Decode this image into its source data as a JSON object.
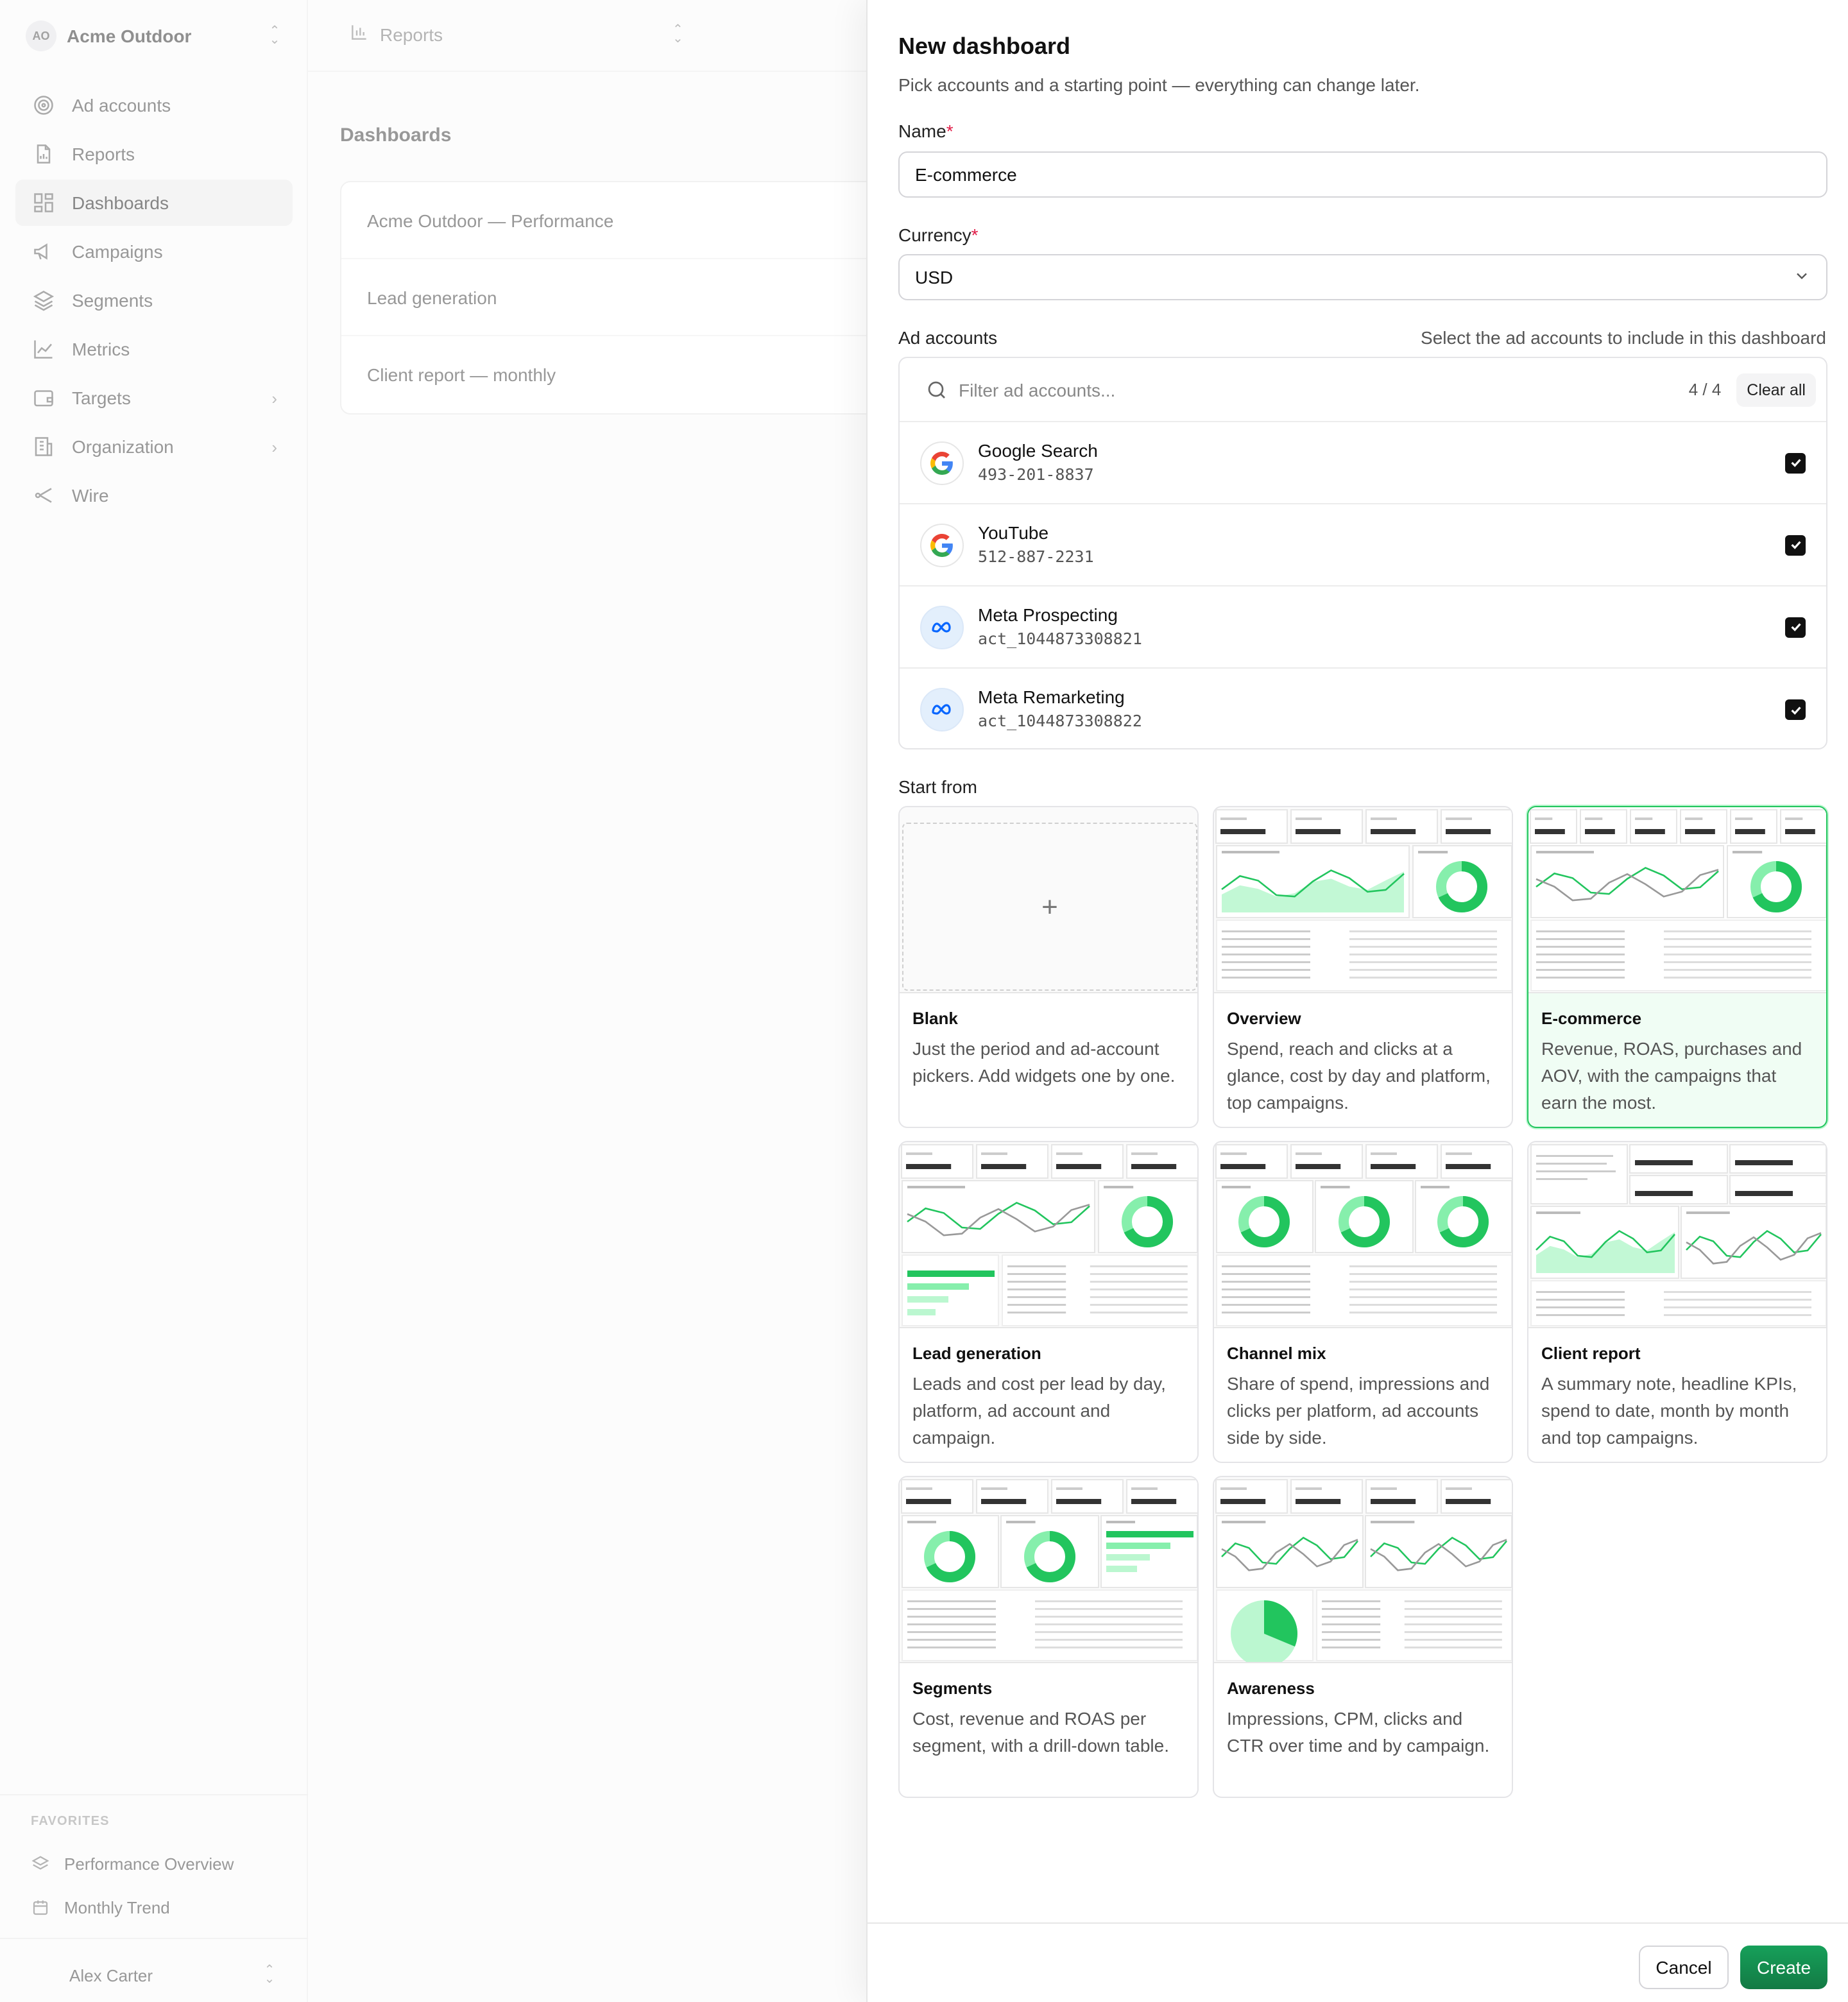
{
  "workspace": {
    "initials": "AO",
    "name": "Acme Outdoor"
  },
  "nav": [
    {
      "label": "Ad accounts",
      "icon": "target-icon"
    },
    {
      "label": "Reports",
      "icon": "file-chart-icon"
    },
    {
      "label": "Dashboards",
      "icon": "grid-icon",
      "active": true
    },
    {
      "label": "Campaigns",
      "icon": "megaphone-icon"
    },
    {
      "label": "Segments",
      "icon": "layers-icon"
    },
    {
      "label": "Metrics",
      "icon": "line-chart-icon"
    },
    {
      "label": "Targets",
      "icon": "wallet-icon",
      "chevron": true
    },
    {
      "label": "Organization",
      "icon": "building-icon",
      "chevron": true
    },
    {
      "label": "Wire",
      "icon": "share-icon"
    }
  ],
  "favorites": {
    "heading": "FAVORITES",
    "items": [
      {
        "label": "Performance Overview",
        "icon": "layers-icon"
      },
      {
        "label": "Monthly Trend",
        "icon": "calendar-icon"
      }
    ]
  },
  "user": {
    "name": "Alex Carter"
  },
  "topbar": {
    "crumb": "Reports"
  },
  "page": {
    "title": "Dashboards",
    "dashboards": [
      "Acme Outdoor — Performance",
      "Lead generation",
      "Client report — monthly"
    ]
  },
  "sheet": {
    "title": "New dashboard",
    "subtitle": "Pick accounts and a starting point — everything can change later.",
    "name_label": "Name",
    "name_value": "E-commerce",
    "currency_label": "Currency",
    "currency_value": "USD",
    "accounts_label": "Ad accounts",
    "accounts_hint": "Select the ad accounts to include in this dashboard",
    "filter_placeholder": "Filter ad accounts...",
    "selected_count": "4 / 4",
    "clear_all": "Clear all",
    "accounts": [
      {
        "name": "Google Search",
        "id": "493-201-8837",
        "platform": "google",
        "checked": true
      },
      {
        "name": "YouTube",
        "id": "512-887-2231",
        "platform": "google",
        "checked": true
      },
      {
        "name": "Meta Prospecting",
        "id": "act_1044873308821",
        "platform": "meta",
        "checked": true
      },
      {
        "name": "Meta Remarketing",
        "id": "act_1044873308822",
        "platform": "meta",
        "checked": true
      }
    ],
    "start_from_label": "Start from",
    "templates": [
      {
        "name": "Blank",
        "desc": "Just the period and ad-account pickers. Add widgets one by one.",
        "selected": false
      },
      {
        "name": "Overview",
        "desc": "Spend, reach and clicks at a glance, cost by day and platform, top campaigns.",
        "selected": false
      },
      {
        "name": "E-commerce",
        "desc": "Revenue, ROAS, purchases and AOV, with the campaigns that earn the most.",
        "selected": true
      },
      {
        "name": "Lead generation",
        "desc": "Leads and cost per lead by day, platform, ad account and campaign.",
        "selected": false
      },
      {
        "name": "Channel mix",
        "desc": "Share of spend, impressions and clicks per platform, ad accounts side by side.",
        "selected": false
      },
      {
        "name": "Client report",
        "desc": "A summary note, headline KPIs, spend to date, month by month and top campaigns.",
        "selected": false
      },
      {
        "name": "Segments",
        "desc": "Cost, revenue and ROAS per segment, with a drill-down table.",
        "selected": false
      },
      {
        "name": "Awareness",
        "desc": "Impressions, CPM, clicks and CTR over time and by campaign.",
        "selected": false
      }
    ],
    "cancel": "Cancel",
    "create": "Create"
  },
  "colors": {
    "accent": "#16a34a",
    "accent_light": "#bbf7d0",
    "primary_button": "#15803d"
  }
}
